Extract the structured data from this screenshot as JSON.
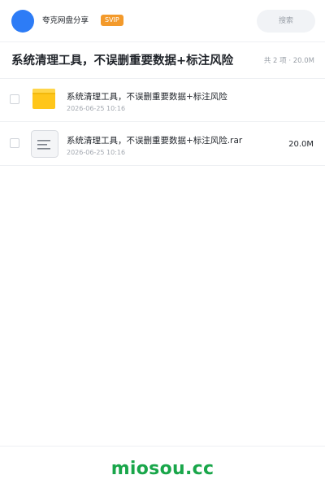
{
  "header": {
    "user_name": "夸克网盘分享",
    "badge": "SVIP",
    "search_placeholder": "搜索"
  },
  "folder": {
    "title": "系统清理工具，不误删重要数据+标注风险",
    "summary": "共 2 项 · 20.0M"
  },
  "files": [
    {
      "name": "系统清理工具，不误删重要数据+标注风险",
      "date": "2026-06-25 10:16",
      "size": "",
      "icon": "folder-icon"
    },
    {
      "name": "系统清理工具，不误删重要数据+标注风险.rar",
      "date": "2026-06-25 10:16",
      "size": "20.0M",
      "icon": "archive-file-icon"
    }
  ],
  "footer": {
    "brand": "miosou.cc"
  },
  "colors": {
    "avatar": "#2d7cf6",
    "badge": "#f39a2b",
    "folder": "#ffc61a",
    "brand": "#19a64a"
  }
}
